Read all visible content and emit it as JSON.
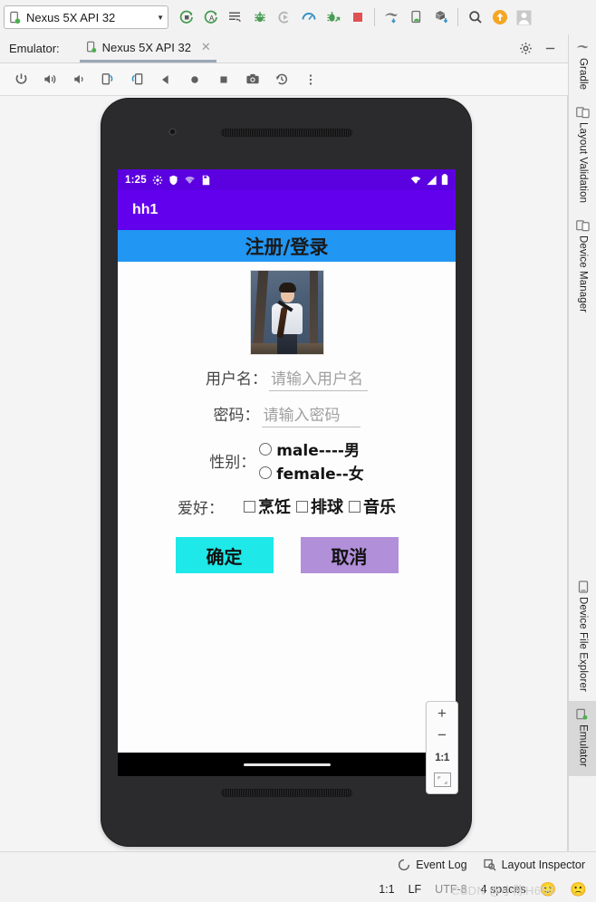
{
  "toolbar": {
    "device_selector": "Nexus 5X API 32",
    "caret": "▼",
    "icons": [
      {
        "name": "run-icon",
        "title": "Run"
      },
      {
        "name": "run-with-coverage-icon",
        "title": "Run with Coverage"
      },
      {
        "name": "apply-changes-icon",
        "title": "Apply Changes"
      },
      {
        "name": "debug-icon",
        "title": "Debug"
      },
      {
        "name": "attach-debugger-icon",
        "title": "Attach Debugger"
      },
      {
        "name": "profiler-icon",
        "title": "Profiler"
      },
      {
        "name": "debug-attach-process-icon",
        "title": "Attach to Process"
      },
      {
        "name": "stop-icon",
        "title": "Stop"
      },
      {
        "name": "gradle-sync-icon",
        "title": "Sync Project with Gradle Files"
      },
      {
        "name": "avd-manager-icon",
        "title": "AVD Manager"
      },
      {
        "name": "sdk-manager-icon",
        "title": "SDK Manager"
      },
      {
        "name": "search-icon",
        "title": "Search Everywhere"
      },
      {
        "name": "update-icon",
        "title": "Update"
      },
      {
        "name": "account-icon",
        "title": "Account"
      }
    ]
  },
  "emulator_tab": {
    "label": "Emulator:",
    "tab_title": "Nexus 5X API 32",
    "close": "✕",
    "settings_icon": "gear-icon",
    "minimize_icon": "minimize-icon"
  },
  "emulator_controls": [
    {
      "name": "power-button",
      "glyph": "power"
    },
    {
      "name": "volume-up-button",
      "glyph": "volume-up"
    },
    {
      "name": "volume-down-button",
      "glyph": "volume-down"
    },
    {
      "name": "rotate-left-button",
      "glyph": "rotate-left"
    },
    {
      "name": "rotate-right-button",
      "glyph": "rotate-right"
    },
    {
      "name": "back-button",
      "glyph": "back"
    },
    {
      "name": "home-button",
      "glyph": "home"
    },
    {
      "name": "overview-button",
      "glyph": "overview"
    },
    {
      "name": "screenshot-button",
      "glyph": "camera"
    },
    {
      "name": "history-button",
      "glyph": "history"
    },
    {
      "name": "more-button",
      "glyph": "more"
    }
  ],
  "device_screen": {
    "status_bar": {
      "time": "1:25",
      "left_icons": [
        "gear-icon",
        "shield-icon",
        "wifi-question-icon",
        "sdcard-icon"
      ],
      "right_icons": [
        "wifi-alert-icon",
        "signal-icon",
        "battery-icon"
      ],
      "background": "#5b01e0"
    },
    "app_bar": {
      "title": "hh1",
      "background": "#6200ee"
    },
    "header_band": {
      "text": "注册/登录",
      "background": "#2196f3"
    },
    "avatar": {
      "alt": "profile-photo"
    },
    "fields": [
      {
        "label": "用户名：",
        "placeholder": "请输入用户名",
        "value": ""
      },
      {
        "label": "密码：",
        "placeholder": "请输入密码",
        "value": ""
      }
    ],
    "gender": {
      "label": "性别：",
      "options": [
        {
          "text": "male----男",
          "checked": false
        },
        {
          "text": "female--女",
          "checked": false
        }
      ]
    },
    "hobby": {
      "label": "爱好：",
      "options": [
        {
          "text": "烹饪",
          "checked": false
        },
        {
          "text": "排球",
          "checked": false
        },
        {
          "text": "音乐",
          "checked": false
        }
      ]
    },
    "buttons": [
      {
        "text": "确定",
        "color": "#1fe8e8"
      },
      {
        "text": "取消",
        "color": "#b18fd9"
      }
    ]
  },
  "zoom_controls": {
    "zoom_in": "+",
    "zoom_out": "−",
    "actual_size": "1:1",
    "fit": "fit-icon"
  },
  "right_sidebar": [
    {
      "label": "Gradle",
      "icon": "gradle-icon",
      "active": false
    },
    {
      "label": "Layout Validation",
      "icon": "layout-validation-icon",
      "active": false
    },
    {
      "label": "Device Manager",
      "icon": "device-manager-icon",
      "active": false
    },
    {
      "label": "Device File Explorer",
      "icon": "device-file-explorer-icon",
      "active": false
    },
    {
      "label": "Emulator",
      "icon": "emulator-icon",
      "active": true
    }
  ],
  "bottom_bar": [
    {
      "label": "Event Log",
      "icon": "event-log-icon"
    },
    {
      "label": "Layout Inspector",
      "icon": "layout-inspector-icon"
    }
  ],
  "status_line": {
    "caret": "1:1",
    "line_separator": "LF",
    "encoding": "UTF-8",
    "indent": "4 spaces",
    "emoji_happy": "🙂",
    "emoji_sad": "🙁"
  },
  "watermark": "CSDN @小陈H656"
}
